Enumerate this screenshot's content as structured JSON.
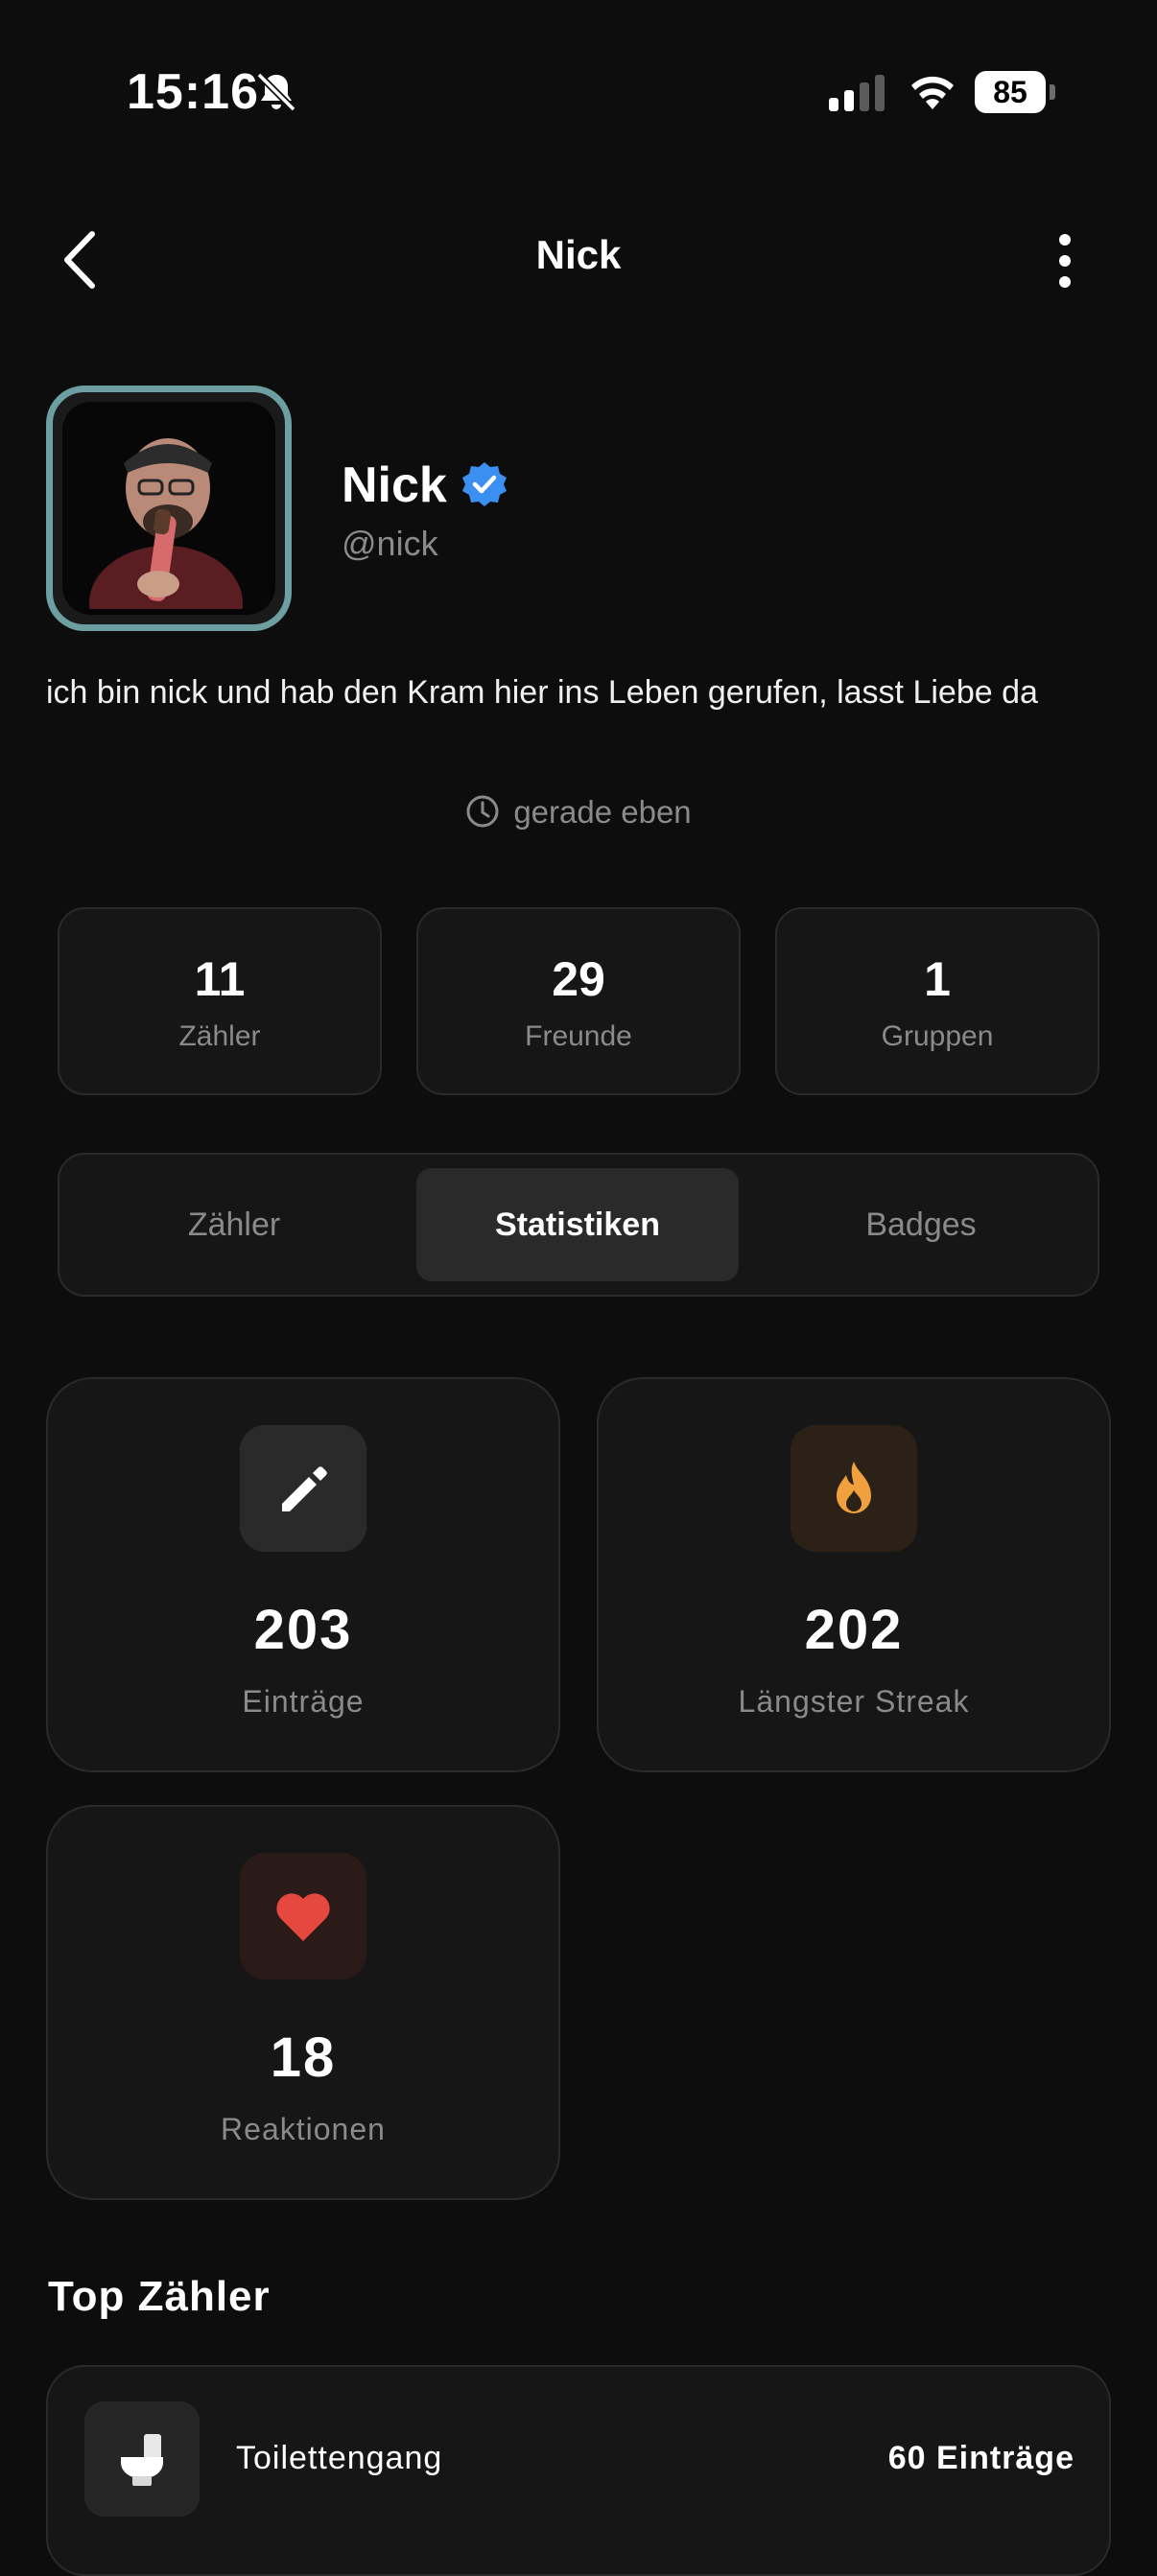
{
  "status_bar": {
    "time": "15:16",
    "battery": "85"
  },
  "nav": {
    "title": "Nick"
  },
  "profile": {
    "name": "Nick",
    "handle": "@nick",
    "bio": "ich bin nick und hab den Kram hier ins Leben gerufen, lasst Liebe da",
    "last_seen": "gerade eben"
  },
  "counts": [
    {
      "value": "11",
      "label": "Zähler"
    },
    {
      "value": "29",
      "label": "Freunde"
    },
    {
      "value": "1",
      "label": "Gruppen"
    }
  ],
  "tabs": [
    {
      "label": "Zähler",
      "active": false
    },
    {
      "label": "Statistiken",
      "active": true
    },
    {
      "label": "Badges",
      "active": false
    }
  ],
  "stats": [
    {
      "value": "203",
      "label": "Einträge",
      "icon": "pencil-icon",
      "icon_color": "#ffffff",
      "icon_bg": "#2a2a2a"
    },
    {
      "value": "202",
      "label": "Längster Streak",
      "icon": "flame-icon",
      "icon_color": "#f0a03c",
      "icon_bg": "#2b2116"
    },
    {
      "value": "18",
      "label": "Reaktionen",
      "icon": "heart-icon",
      "icon_color": "#e5483e",
      "icon_bg": "#2a1a18"
    }
  ],
  "top_counters": {
    "title": "Top Zähler",
    "items": [
      {
        "name": "Toilettengang",
        "count": "60 Einträge",
        "icon": "toilet-icon"
      }
    ]
  },
  "colors": {
    "background": "#0d0d0d",
    "card": "#161616",
    "verified": "#3b8ff0",
    "avatar_border": "#6d9ea1"
  }
}
